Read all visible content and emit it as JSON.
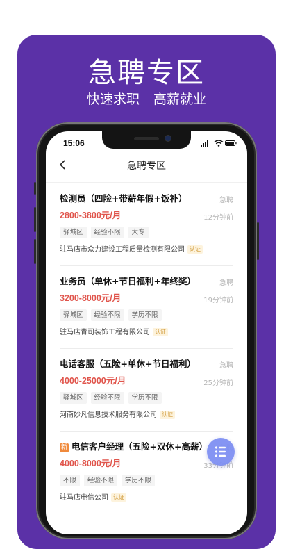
{
  "promo": {
    "headline": "急聘专区",
    "subheadline": "快速求职 高薪就业",
    "background_color": "#5b31a7"
  },
  "status_bar": {
    "time": "15:06"
  },
  "nav": {
    "title": "急聘专区",
    "back_icon": "chevron-left-icon"
  },
  "jobs": [
    {
      "title": "检测员（四险+带薪年假+饭补）",
      "urgent": "急聘",
      "salary": "2800-3800元/月",
      "posted": "12分钟前",
      "tags": [
        "驿城区",
        "经验不限",
        "大专"
      ],
      "company": "驻马店市众力建设工程质量检测有限公司",
      "verified": "认证",
      "is_new": false
    },
    {
      "title": "业务员（单休+节日福利+年终奖）",
      "urgent": "急聘",
      "salary": "3200-8000元/月",
      "posted": "19分钟前",
      "tags": [
        "驿城区",
        "经验不限",
        "学历不限"
      ],
      "company": "驻马店青司装饰工程有限公司",
      "verified": "认证",
      "is_new": false
    },
    {
      "title": "电话客服（五险+单休+节日福利）",
      "urgent": "急聘",
      "salary": "4000-25000元/月",
      "posted": "25分钟前",
      "tags": [
        "驿城区",
        "经验不限",
        "学历不限"
      ],
      "company": "河南妙凡信息技术服务有限公司",
      "verified": "认证",
      "is_new": false
    },
    {
      "title": "电信客户经理（五险+双休+高薪）",
      "urgent": "急聘",
      "salary": "4000-8000元/月",
      "posted": "33分钟前",
      "tags": [
        "不限",
        "经验不限",
        "学历不限"
      ],
      "company": "驻马店电信公司",
      "verified": "认证",
      "is_new": true,
      "new_badge": "新"
    }
  ],
  "fab": {
    "icon": "list-icon",
    "color": "#7c8ef3"
  },
  "colors": {
    "salary": "#e0544b",
    "accent": "#5b31a7"
  }
}
